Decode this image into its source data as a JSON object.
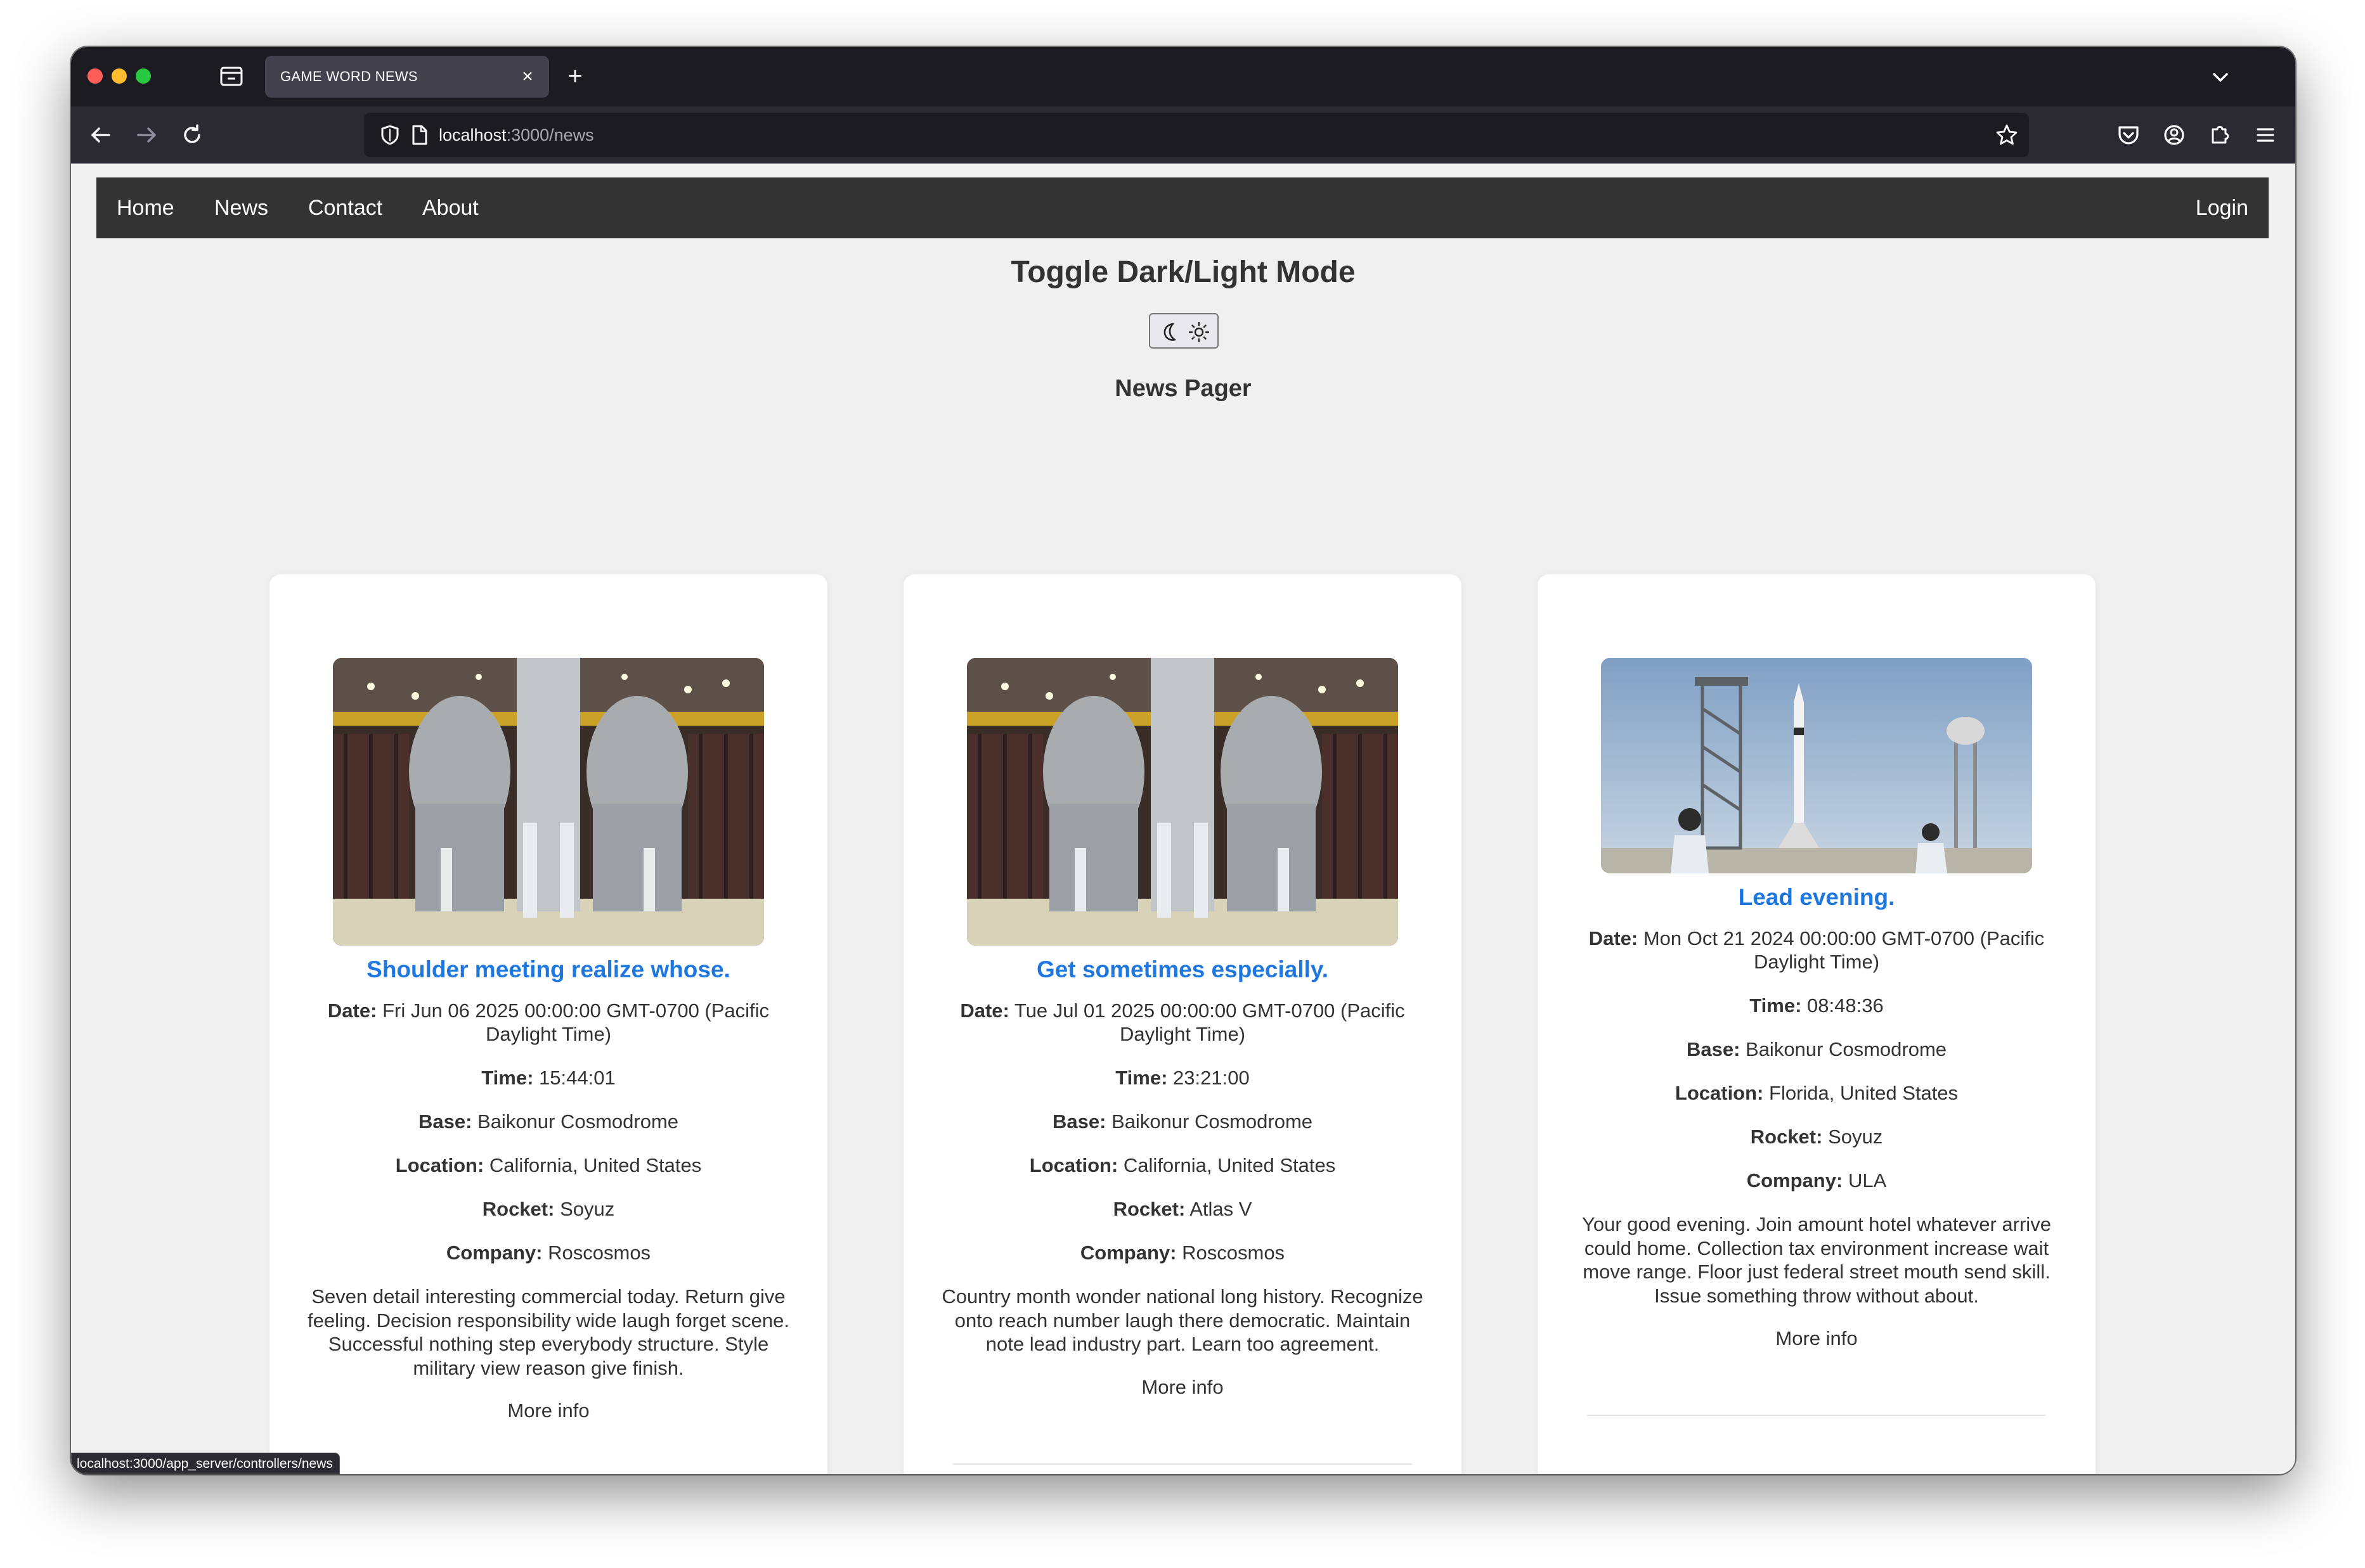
{
  "browser": {
    "tab_title": "GAME WORD NEWS",
    "url_host": "localhost",
    "url_path": ":3000/news",
    "status_url": "localhost:3000/app_server/controllers/news"
  },
  "nav": {
    "links": [
      "Home",
      "News",
      "Contact",
      "About"
    ],
    "login": "Login"
  },
  "page": {
    "toggle_heading": "Toggle Dark/Light Mode",
    "pager_heading": "News Pager"
  },
  "labels": {
    "date": "Date:",
    "time": "Time:",
    "base": "Base:",
    "location": "Location:",
    "rocket": "Rocket:",
    "company": "Company:"
  },
  "cards": [
    {
      "image": "rocket-hangar-photo",
      "title": "Shoulder meeting realize whose.",
      "date": "Fri Jun 06 2025 00:00:00 GMT-0700 (Pacific Daylight Time)",
      "time": "15:44:01",
      "base": "Baikonur Cosmodrome",
      "location": "California, United States",
      "rocket": "Soyuz",
      "company": "Roscosmos",
      "description": "Seven detail interesting commercial today. Return give feeling. Decision responsibility wide laugh forget scene. Successful nothing step everybody structure. Style military view reason give finish.",
      "more": "More info"
    },
    {
      "image": "rocket-hangar-photo",
      "title": "Get sometimes especially.",
      "date": "Tue Jul 01 2025 00:00:00 GMT-0700 (Pacific Daylight Time)",
      "time": "23:21:00",
      "base": "Baikonur Cosmodrome",
      "location": "California, United States",
      "rocket": "Atlas V",
      "company": "Roscosmos",
      "description": "Country month wonder national long history. Recognize onto reach number laugh there democratic. Maintain note lead industry part. Learn too agreement.",
      "more": "More info"
    },
    {
      "image": "launch-pad-photo",
      "title": "Lead evening.",
      "date": "Mon Oct 21 2024 00:00:00 GMT-0700 (Pacific Daylight Time)",
      "time": "08:48:36",
      "base": "Baikonur Cosmodrome",
      "location": "Florida, United States",
      "rocket": "Soyuz",
      "company": "ULA",
      "description": "Your good evening. Join amount hotel whatever arrive could home. Collection tax environment increase wait move range. Floor just federal street mouth send skill. Issue something throw without about.",
      "more": "More info"
    }
  ]
}
